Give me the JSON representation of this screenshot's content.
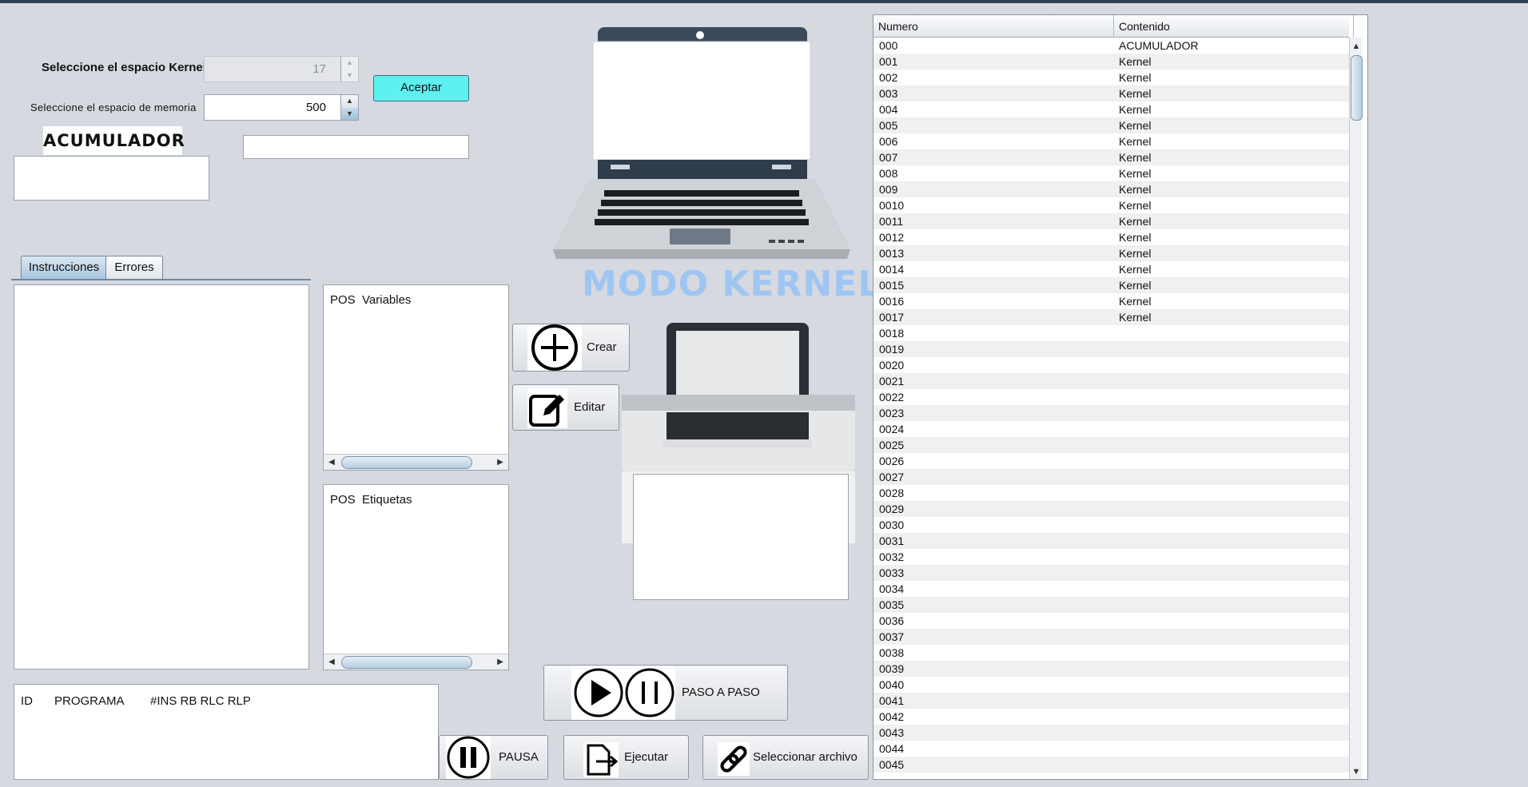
{
  "kernel": {
    "label": "Seleccione el espacio Kernel",
    "value": "17",
    "up_glyph": "▲",
    "down_glyph": "▼"
  },
  "memory": {
    "label": "Seleccione el espacio de memoria",
    "value": "500",
    "up_glyph": "▲",
    "down_glyph": "▼"
  },
  "accept_label": "Aceptar",
  "accumulator": {
    "title": "ACUMULADOR",
    "value": ""
  },
  "right_field_value": "",
  "tabs": [
    {
      "label": "Instrucciones",
      "active": true
    },
    {
      "label": "Errores",
      "active": false
    }
  ],
  "variables_header": "POS  Variables",
  "labels_header": "POS  Etiquetas",
  "scroll_glyphs": {
    "left": "◀",
    "right": "▶",
    "up": "▲",
    "down": "▼"
  },
  "buttons": {
    "crear": "Crear",
    "editar": "Editar",
    "paso": "PASO A PASO",
    "pausa": "PAUSA",
    "ejecutar": "Ejecutar",
    "seleccionar": "Seleccionar archivo"
  },
  "icons": {
    "crear": "plus-circle-icon",
    "editar": "edit-icon",
    "play": "play-icon",
    "pause": "pause-icon",
    "ejecutar": "file-export-icon",
    "seleccionar": "link-icon",
    "laptop": "laptop-icon",
    "printer": "printer-icon"
  },
  "modo_label": "MODO KERNEL",
  "program_header": [
    "ID",
    "PROGRAMA",
    "#INS RB RLC RLP"
  ],
  "memory_table": {
    "headers": [
      "Numero",
      "Contenido"
    ],
    "rows": [
      [
        "000",
        "ACUMULADOR"
      ],
      [
        "001",
        "Kernel"
      ],
      [
        "002",
        "Kernel"
      ],
      [
        "003",
        "Kernel"
      ],
      [
        "004",
        "Kernel"
      ],
      [
        "005",
        "Kernel"
      ],
      [
        "006",
        "Kernel"
      ],
      [
        "007",
        "Kernel"
      ],
      [
        "008",
        "Kernel"
      ],
      [
        "009",
        "Kernel"
      ],
      [
        "0010",
        "Kernel"
      ],
      [
        "0011",
        "Kernel"
      ],
      [
        "0012",
        "Kernel"
      ],
      [
        "0013",
        "Kernel"
      ],
      [
        "0014",
        "Kernel"
      ],
      [
        "0015",
        "Kernel"
      ],
      [
        "0016",
        "Kernel"
      ],
      [
        "0017",
        "Kernel"
      ],
      [
        "0018",
        ""
      ],
      [
        "0019",
        ""
      ],
      [
        "0020",
        ""
      ],
      [
        "0021",
        ""
      ],
      [
        "0022",
        ""
      ],
      [
        "0023",
        ""
      ],
      [
        "0024",
        ""
      ],
      [
        "0025",
        ""
      ],
      [
        "0026",
        ""
      ],
      [
        "0027",
        ""
      ],
      [
        "0028",
        ""
      ],
      [
        "0029",
        ""
      ],
      [
        "0030",
        ""
      ],
      [
        "0031",
        ""
      ],
      [
        "0032",
        ""
      ],
      [
        "0033",
        ""
      ],
      [
        "0034",
        ""
      ],
      [
        "0035",
        ""
      ],
      [
        "0036",
        ""
      ],
      [
        "0037",
        ""
      ],
      [
        "0038",
        ""
      ],
      [
        "0039",
        ""
      ],
      [
        "0040",
        ""
      ],
      [
        "0041",
        ""
      ],
      [
        "0042",
        ""
      ],
      [
        "0043",
        ""
      ],
      [
        "0044",
        ""
      ],
      [
        "0045",
        ""
      ]
    ]
  },
  "colors": {
    "background": "#d6d9df",
    "accept": "#5ff0f0",
    "modo": "#9fc6f3"
  }
}
